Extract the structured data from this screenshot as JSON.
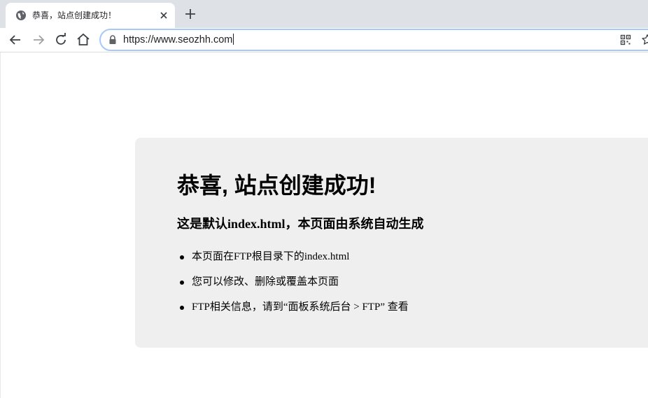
{
  "browser": {
    "tab": {
      "title": "恭喜，站点创建成功！"
    },
    "address_bar": {
      "url": "https://www.seozhh.com"
    }
  },
  "page": {
    "heading": "恭喜, 站点创建成功!",
    "subheading": "这是默认index.html，本页面由系统自动生成",
    "bullets": [
      "本页面在FTP根目录下的index.html",
      "您可以修改、删除或覆盖本页面",
      "FTP相关信息，请到“面板系统后台 > FTP” 查看"
    ]
  },
  "icons": {
    "tab_favicon": "globe-icon",
    "tab_close": "close-icon",
    "new_tab": "plus-icon",
    "back": "back-arrow-icon",
    "forward": "forward-arrow-icon",
    "reload": "reload-icon",
    "home": "home-icon",
    "lock": "lock-icon",
    "qr": "qr-code-icon",
    "bookmark": "star-icon"
  },
  "colors": {
    "tabstrip_bg": "#dee1e6",
    "card_bg": "#efefef",
    "omnibox_border": "#a8c7fa"
  }
}
